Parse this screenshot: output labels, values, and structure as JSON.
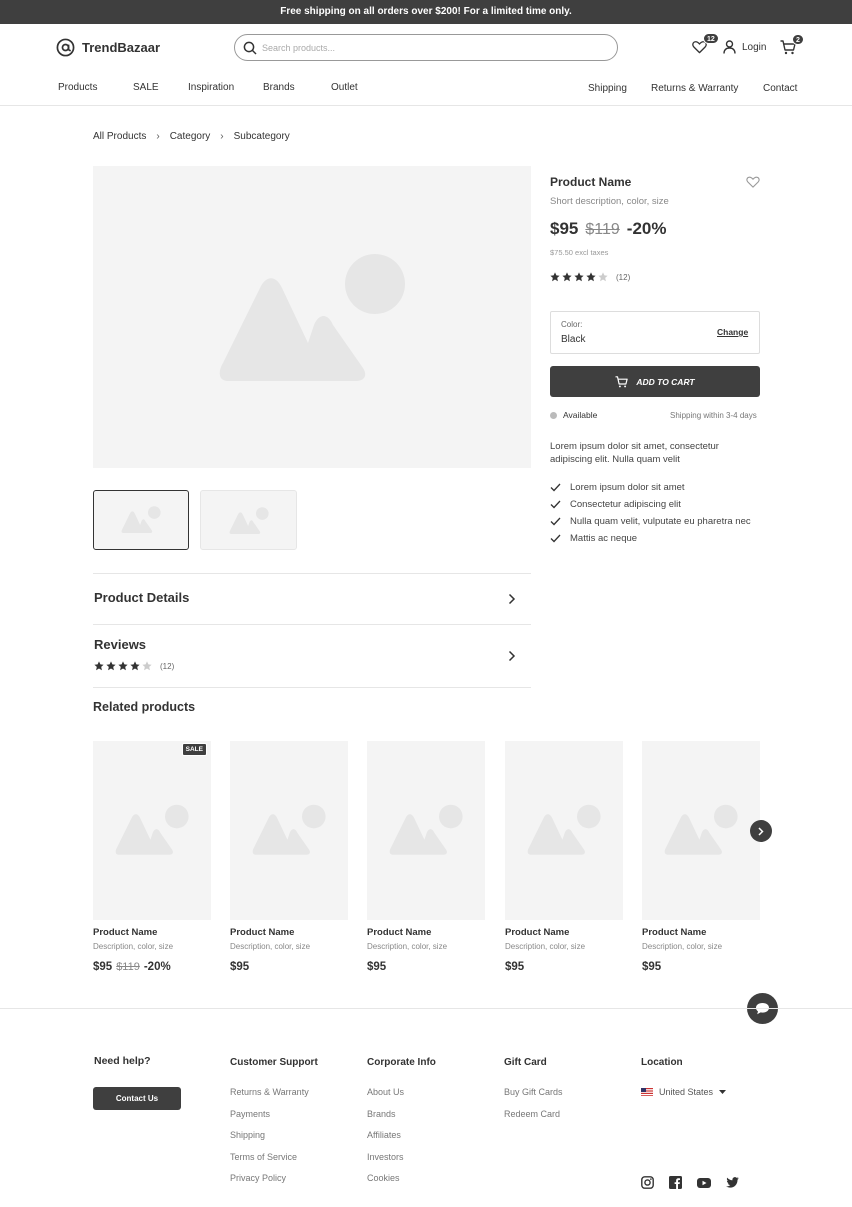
{
  "promo_banner": "Free shipping on all orders over $200! For a limited time only.",
  "brand": {
    "name": "TrendBazaar",
    "icon": "at-sign-icon"
  },
  "search": {
    "placeholder": "Search products..."
  },
  "header": {
    "wishlist_count": "12",
    "login_label": "Login",
    "cart_count": "2"
  },
  "nav": {
    "left": [
      "Products",
      "SALE",
      "Inspiration",
      "Brands",
      "Outlet"
    ],
    "right": [
      "Shipping",
      "Returns & Warranty",
      "Contact"
    ]
  },
  "breadcrumb": [
    "All Products",
    "Category",
    "Subcategory"
  ],
  "product": {
    "name": "Product Name",
    "description": "Short description, color, size",
    "price": "$95",
    "old_price": "$119",
    "discount": "-20%",
    "price_excl": "$75.50 excl taxes",
    "rating": 4,
    "review_count": "(12)",
    "color_label": "Color:",
    "color_value": "Black",
    "change_label": "Change",
    "add_to_cart": "ADD TO CART",
    "availability": "Available",
    "shipping_time": "Shipping within 3-4 days",
    "summary": "Lorem ipsum dolor sit amet, consectetur adipiscing elit. Nulla quam velit",
    "features": [
      "Lorem ipsum dolor sit amet",
      "Consectetur adipiscing elit",
      "Nulla quam velit, vulputate eu pharetra nec",
      "Mattis ac neque"
    ]
  },
  "accordion": {
    "details_title": "Product Details",
    "reviews_title": "Reviews",
    "reviews_rating": 4,
    "reviews_count": "(12)"
  },
  "related": {
    "title": "Related products",
    "sale_badge": "SALE",
    "items": [
      {
        "name": "Product Name",
        "desc": "Description, color, size",
        "price": "$95",
        "old_price": "$119",
        "discount": "-20%"
      },
      {
        "name": "Product Name",
        "desc": "Description, color, size",
        "price": "$95"
      },
      {
        "name": "Product Name",
        "desc": "Description, color, size",
        "price": "$95"
      },
      {
        "name": "Product Name",
        "desc": "Description, color, size",
        "price": "$95"
      },
      {
        "name": "Product Name",
        "desc": "Description, color, size",
        "price": "$95"
      }
    ]
  },
  "footer": {
    "help_title": "Need help?",
    "contact_button": "Contact Us",
    "columns": [
      {
        "title": "Customer Support",
        "links": [
          "Returns & Warranty",
          "Payments",
          "Shipping",
          "Terms of Service",
          "Privacy Policy"
        ]
      },
      {
        "title": "Corporate Info",
        "links": [
          "About Us",
          "Brands",
          "Affiliates",
          "Investors",
          "Cookies"
        ]
      },
      {
        "title": "Gift Card",
        "links": [
          "Buy Gift Cards",
          "Redeem Card"
        ]
      }
    ],
    "location_title": "Location",
    "location_value": "United States",
    "social": [
      "instagram-icon",
      "facebook-icon",
      "youtube-icon",
      "twitter-icon"
    ]
  },
  "colors": {
    "dark": "#3f3f3f",
    "placeholder_bg": "#f4f4f4",
    "placeholder_shape": "#e6e6e6",
    "star_off": "#cccccc"
  }
}
